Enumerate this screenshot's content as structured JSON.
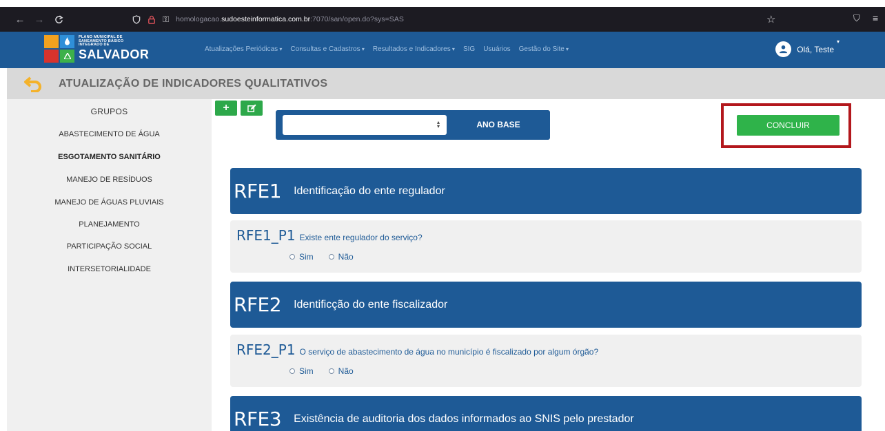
{
  "browser": {
    "url_prefix": "homologacao.",
    "url_host": "sudoesteinformatica.com.br",
    "url_suffix": ":7070/san/open.do?sys=SAS"
  },
  "header": {
    "logo_line1": "PLANO MUNICIPAL DE",
    "logo_line2": "SANEAMENTO BÁSICO",
    "logo_line3": "INTEGRADO DE",
    "logo_big": "SALVADOR",
    "nav": [
      "Atualizações Periódicas",
      "Consultas e Cadastros",
      "Resultados e Indicadores",
      "SIG",
      "Usuários",
      "Gestão do Site"
    ],
    "greeting": "Olá, Teste"
  },
  "page": {
    "title": "ATUALIZAÇÃO DE INDICADORES QUALITATIVOS"
  },
  "sidebar": {
    "heading": "GRUPOS",
    "items": [
      "ABASTECIMENTO DE ÁGUA",
      "ESGOTAMENTO SANITÁRIO",
      "MANEJO DE RESÍDUOS",
      "MANEJO DE ÁGUAS PLUVIAIS",
      "PLANEJAMENTO",
      "PARTICIPAÇÃO SOCIAL",
      "INTERSETORIALIDADE"
    ],
    "active_index": 1
  },
  "toolbar": {
    "add_label": "+",
    "select_value": "",
    "year_label": "ANO BASE",
    "conclude_label": "CONCLUIR"
  },
  "sections": [
    {
      "code": "RFE1",
      "title": "Identificação do ente regulador",
      "question": {
        "code": "RFE1_P1",
        "text": "Existe ente regulador do serviço?",
        "options": [
          "Sim",
          "Não"
        ]
      }
    },
    {
      "code": "RFE2",
      "title": "Identificção do ente fiscalizador",
      "question": {
        "code": "RFE2_P1",
        "text": "O serviço de abastecimento de água no município é fiscalizado por algum órgão?",
        "options": [
          "Sim",
          "Não"
        ]
      }
    },
    {
      "code": "RFE3",
      "title": "Existência de auditoria dos dados informados ao SNIS pelo prestador"
    }
  ],
  "colors": {
    "primary": "#1e5a96",
    "success": "#2fb34a",
    "highlight_border": "#b3171c",
    "titlebar": "#d9d9d9",
    "sidebar": "#f0f0f0"
  }
}
